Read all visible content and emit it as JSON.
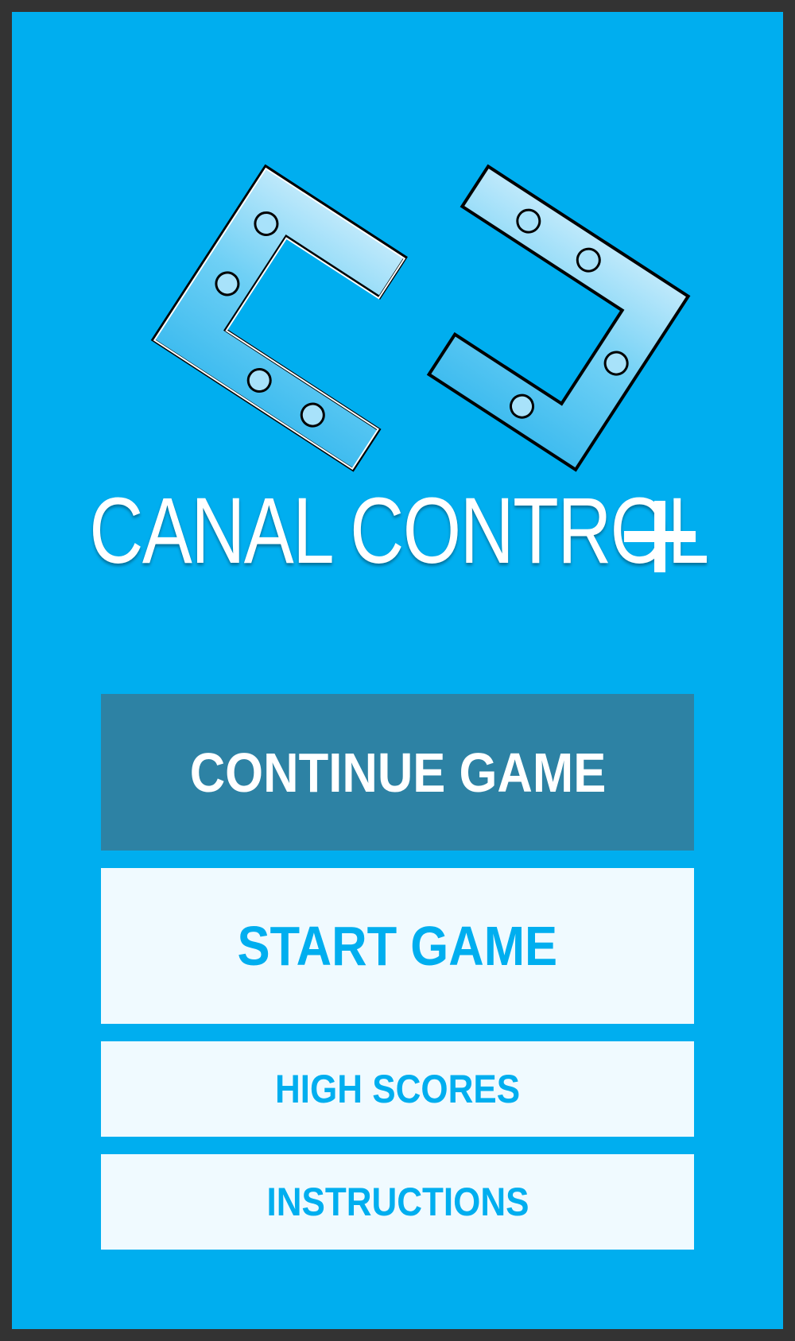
{
  "game": {
    "title": "CANAL CONTROL",
    "title_suffix_icon": "plus-icon",
    "logo_icon": "canal-pipes-logo-icon"
  },
  "menu": {
    "continue_label": "CONTINUE GAME",
    "start_label": "START GAME",
    "high_scores_label": "HIGH SCORES",
    "instructions_label": "INSTRUCTIONS"
  },
  "colors": {
    "frame": "#333333",
    "background": "#00aeef",
    "continue_button": "#2d82a4",
    "light_button": "#f0faff",
    "light_button_text": "#00aeef",
    "title_text": "#ffffff"
  }
}
